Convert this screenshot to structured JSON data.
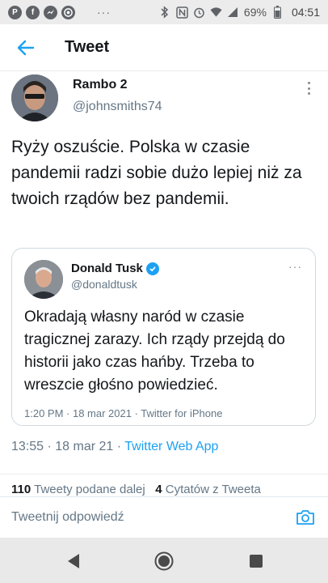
{
  "status_bar": {
    "app_icons": [
      "pinterest-icon",
      "facebook-icon",
      "messenger-icon",
      "chrome-icon"
    ],
    "more": "···",
    "battery": "69%",
    "time": "04:51"
  },
  "header": {
    "title": "Tweet",
    "back_icon": "arrow-left-icon"
  },
  "tweet": {
    "author_name": "Rambo 2",
    "author_handle": "@johnsmiths74",
    "text": "Ryży oszuście. Polska w czasie pandemii radzi sobie dużo lepiej niż za twoich rządów bez pandemii.",
    "time": "13:55",
    "date": "18 mar 21",
    "source": "Twitter Web App",
    "retweets_count": "110",
    "retweets_label": "Tweety podane dalej",
    "quotes_count": "4",
    "quotes_label": "Cytatów z Tweeta"
  },
  "quoted": {
    "author_name": "Donald Tusk",
    "author_handle": "@donaldtusk",
    "more": "···",
    "text": "Okradają własny naród w czasie tragicznej zarazy. Ich rządy przejdą do historii jako czas hańby. Trzeba to wreszcie głośno powiedzieć.",
    "meta": "1:20 PM · 18 mar 2021 · Twitter for iPhone"
  },
  "reply": {
    "placeholder": "Tweetnij odpowiedź"
  },
  "colors": {
    "accent": "#1da1f2",
    "secondary_text": "#657786",
    "primary_text": "#14171a"
  }
}
